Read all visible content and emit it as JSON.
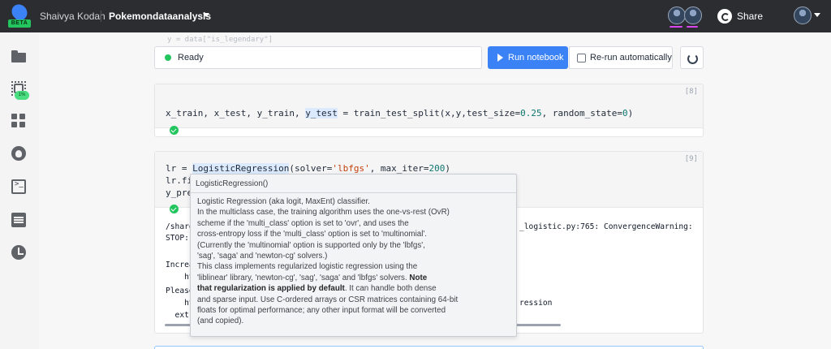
{
  "topbar": {
    "user": "Shaivya Kodan",
    "project": "Pokemondataanalysis",
    "logo_badge": "BETA",
    "share_label": "Share",
    "icons": [
      "logo-icon",
      "chevron-down-icon",
      "share-icon",
      "avatar"
    ]
  },
  "sidebar": {
    "items": [
      {
        "name": "folder-icon"
      },
      {
        "name": "chip-icon",
        "badge": "1%"
      },
      {
        "name": "apps-grid-icon"
      },
      {
        "name": "github-icon"
      },
      {
        "name": "terminal-icon"
      },
      {
        "name": "chat-icon"
      },
      {
        "name": "history-icon"
      }
    ]
  },
  "toolbar": {
    "status": "Ready",
    "run_label": "Run notebook",
    "rerun_label": "Re-run automatically",
    "rerun_checked": false,
    "status_color": "#22c55e",
    "accent_color": "#3b82f6"
  },
  "faded_line": "y = data[\"is_legendary\"]",
  "cell8": {
    "number": "[8]",
    "code": {
      "a": "x_train, x_test, y_train, ",
      "b": "y_test",
      "c": " = train_test_split(x,y,test_size=",
      "d": "0.25",
      "e": ", random_state=",
      "f": "0",
      "g": ")"
    }
  },
  "cell9": {
    "number": "[9]",
    "code": {
      "l1a": "lr = ",
      "l1b": "LogisticRegression",
      "l1c": "(solver=",
      "l1d": "'lbfgs'",
      "l1e": ", max_iter=",
      "l1f": "200",
      "l1g": ")",
      "l2": "lr.fi",
      "l3": "y_pre"
    },
    "output": {
      "o1a": "/share",
      "o1b": "_logistic.py:765: ConvergenceWarning:",
      "o2": "STOP:",
      "o3": "Increa",
      "o4": "    ht",
      "o5": "Please",
      "o6a": "    ht",
      "o6b": "ression",
      "o7": "  extr"
    }
  },
  "tooltip": {
    "title": "LogisticRegression()",
    "lines": [
      "Logistic Regression (aka logit, MaxEnt) classifier.",
      "In the multiclass case, the training algorithm uses the one-vs-rest (OvR)",
      "scheme if the 'multi_class' option is set to 'ovr', and uses the",
      "cross-entropy loss if the 'multi_class' option is set to 'multinomial'.",
      "(Currently the 'multinomial' option is supported only by the 'lbfgs',",
      "'sag', 'saga' and 'newton-cg' solvers.)",
      "This class implements regularized logistic regression using the",
      "'liblinear' library, 'newton-cg', 'sag', 'saga' and 'lbfgs' solvers.",
      "Note",
      "that regularization is applied by default",
      ". It can handle both dense",
      "and sparse input. Use C-ordered arrays or CSR matrices containing 64-bit",
      "floats for optimal performance; any other input format will be converted",
      "(and copied)."
    ]
  }
}
